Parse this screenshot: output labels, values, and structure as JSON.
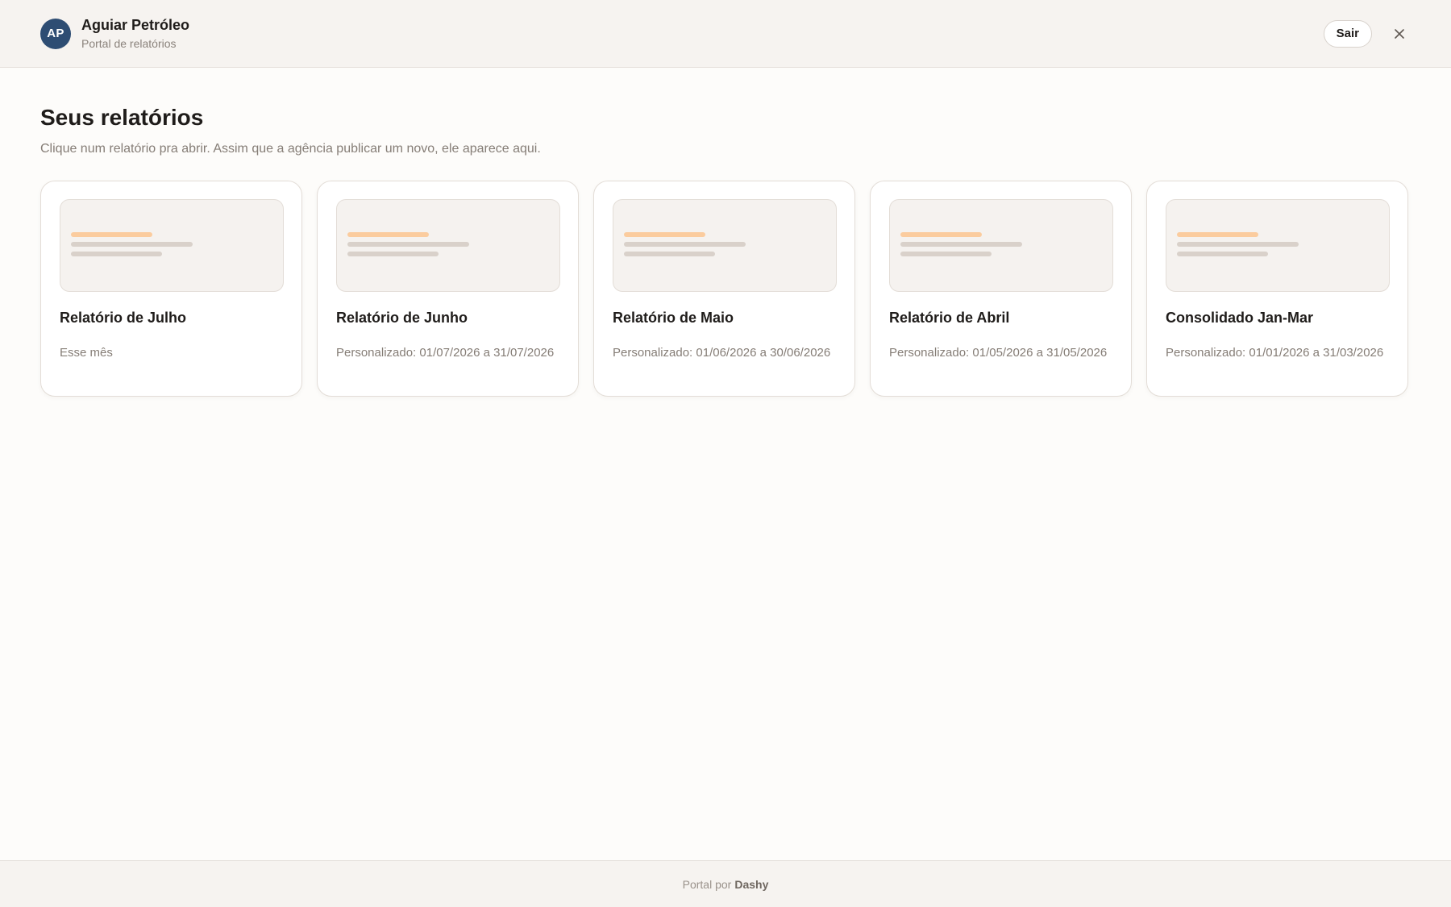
{
  "header": {
    "avatar_initials": "AP",
    "avatar_color": "#2e4d73",
    "company_name": "Aguiar Petróleo",
    "portal_label": "Portal de relatórios",
    "logout_label": "Sair",
    "close_icon": "close-icon"
  },
  "main": {
    "title": "Seus relatórios",
    "subtitle": "Clique num relatório pra abrir. Assim que a agência publicar um novo, ele aparece aqui.",
    "reports": [
      {
        "title": "Relatório de Julho",
        "period": "Esse mês"
      },
      {
        "title": "Relatório de Junho",
        "period": "Personalizado: 01/07/2026 a 31/07/2026"
      },
      {
        "title": "Relatório de Maio",
        "period": "Personalizado: 01/06/2026 a 30/06/2026"
      },
      {
        "title": "Relatório de Abril",
        "period": "Personalizado: 01/05/2026 a 31/05/2026"
      },
      {
        "title": "Consolidado Jan-Mar",
        "period": "Personalizado: 01/01/2026 a 31/03/2026"
      }
    ]
  },
  "footer": {
    "prefix": "Portal por",
    "brand": "Dashy"
  },
  "colors": {
    "accent": "#fbcc9e",
    "avatar": "#2e4d73"
  }
}
